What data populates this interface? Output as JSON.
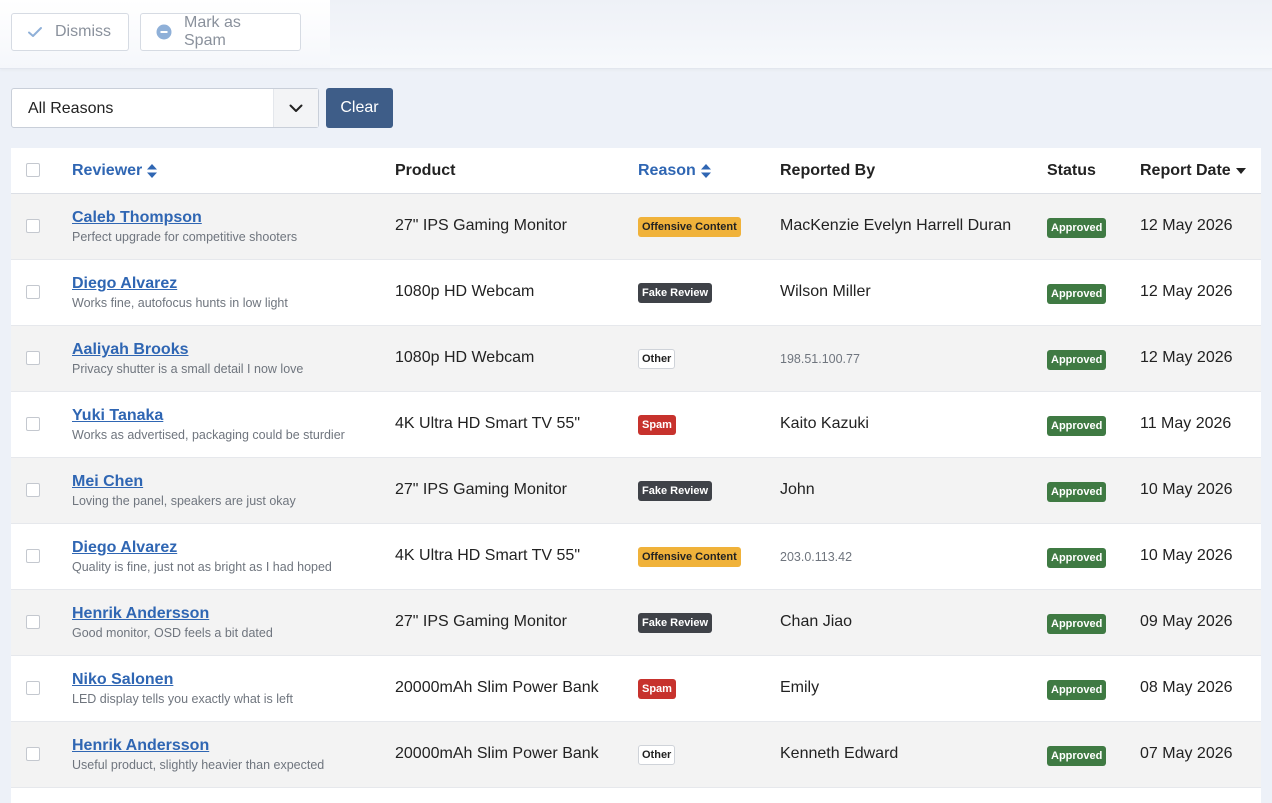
{
  "toolbar": {
    "dismiss_label": "Dismiss",
    "spam_label": "Mark as Spam"
  },
  "filter": {
    "selected": "All Reasons",
    "clear_label": "Clear"
  },
  "columns": {
    "reviewer": "Reviewer",
    "product": "Product",
    "reason": "Reason",
    "reported_by": "Reported By",
    "status": "Status",
    "report_date": "Report Date"
  },
  "colors": {
    "link": "#2f66b3",
    "primary_button": "#3e5d88",
    "offensive": "#f0b23a",
    "fake": "#3f4248",
    "spam": "#c7322d",
    "approved": "#3f7a43"
  },
  "rows": [
    {
      "reviewer": "Caleb Thompson",
      "comment": "Perfect upgrade for competitive shooters",
      "product": "27\" IPS Gaming Monitor",
      "reason": "Offensive Content",
      "reason_type": "offensive",
      "reported_by": "MacKenzie Evelyn Harrell Duran",
      "reporter_is_ip": false,
      "status": "Approved",
      "date": "12 May 2026"
    },
    {
      "reviewer": "Diego Alvarez",
      "comment": "Works fine, autofocus hunts in low light",
      "product": "1080p HD Webcam",
      "reason": "Fake Review",
      "reason_type": "fake",
      "reported_by": "Wilson Miller",
      "reporter_is_ip": false,
      "status": "Approved",
      "date": "12 May 2026"
    },
    {
      "reviewer": "Aaliyah Brooks",
      "comment": "Privacy shutter is a small detail I now love",
      "product": "1080p HD Webcam",
      "reason": "Other",
      "reason_type": "other",
      "reported_by": "198.51.100.77",
      "reporter_is_ip": true,
      "status": "Approved",
      "date": "12 May 2026"
    },
    {
      "reviewer": "Yuki Tanaka",
      "comment": "Works as advertised, packaging could be sturdier",
      "product": "4K Ultra HD Smart TV 55\"",
      "reason": "Spam",
      "reason_type": "spam",
      "reported_by": "Kaito Kazuki",
      "reporter_is_ip": false,
      "status": "Approved",
      "date": "11 May 2026"
    },
    {
      "reviewer": "Mei Chen",
      "comment": "Loving the panel, speakers are just okay",
      "product": "27\" IPS Gaming Monitor",
      "reason": "Fake Review",
      "reason_type": "fake",
      "reported_by": "John",
      "reporter_is_ip": false,
      "status": "Approved",
      "date": "10 May 2026"
    },
    {
      "reviewer": "Diego Alvarez",
      "comment": "Quality is fine, just not as bright as I had hoped",
      "product": "4K Ultra HD Smart TV 55\"",
      "reason": "Offensive Content",
      "reason_type": "offensive",
      "reported_by": "203.0.113.42",
      "reporter_is_ip": true,
      "status": "Approved",
      "date": "10 May 2026"
    },
    {
      "reviewer": "Henrik Andersson",
      "comment": "Good monitor, OSD feels a bit dated",
      "product": "27\" IPS Gaming Monitor",
      "reason": "Fake Review",
      "reason_type": "fake",
      "reported_by": "Chan Jiao",
      "reporter_is_ip": false,
      "status": "Approved",
      "date": "09 May 2026"
    },
    {
      "reviewer": "Niko Salonen",
      "comment": "LED display tells you exactly what is left",
      "product": "20000mAh Slim Power Bank",
      "reason": "Spam",
      "reason_type": "spam",
      "reported_by": "Emily",
      "reporter_is_ip": false,
      "status": "Approved",
      "date": "08 May 2026"
    },
    {
      "reviewer": "Henrik Andersson",
      "comment": "Useful product, slightly heavier than expected",
      "product": "20000mAh Slim Power Bank",
      "reason": "Other",
      "reason_type": "other",
      "reported_by": "Kenneth Edward",
      "reporter_is_ip": false,
      "status": "Approved",
      "date": "07 May 2026"
    }
  ]
}
